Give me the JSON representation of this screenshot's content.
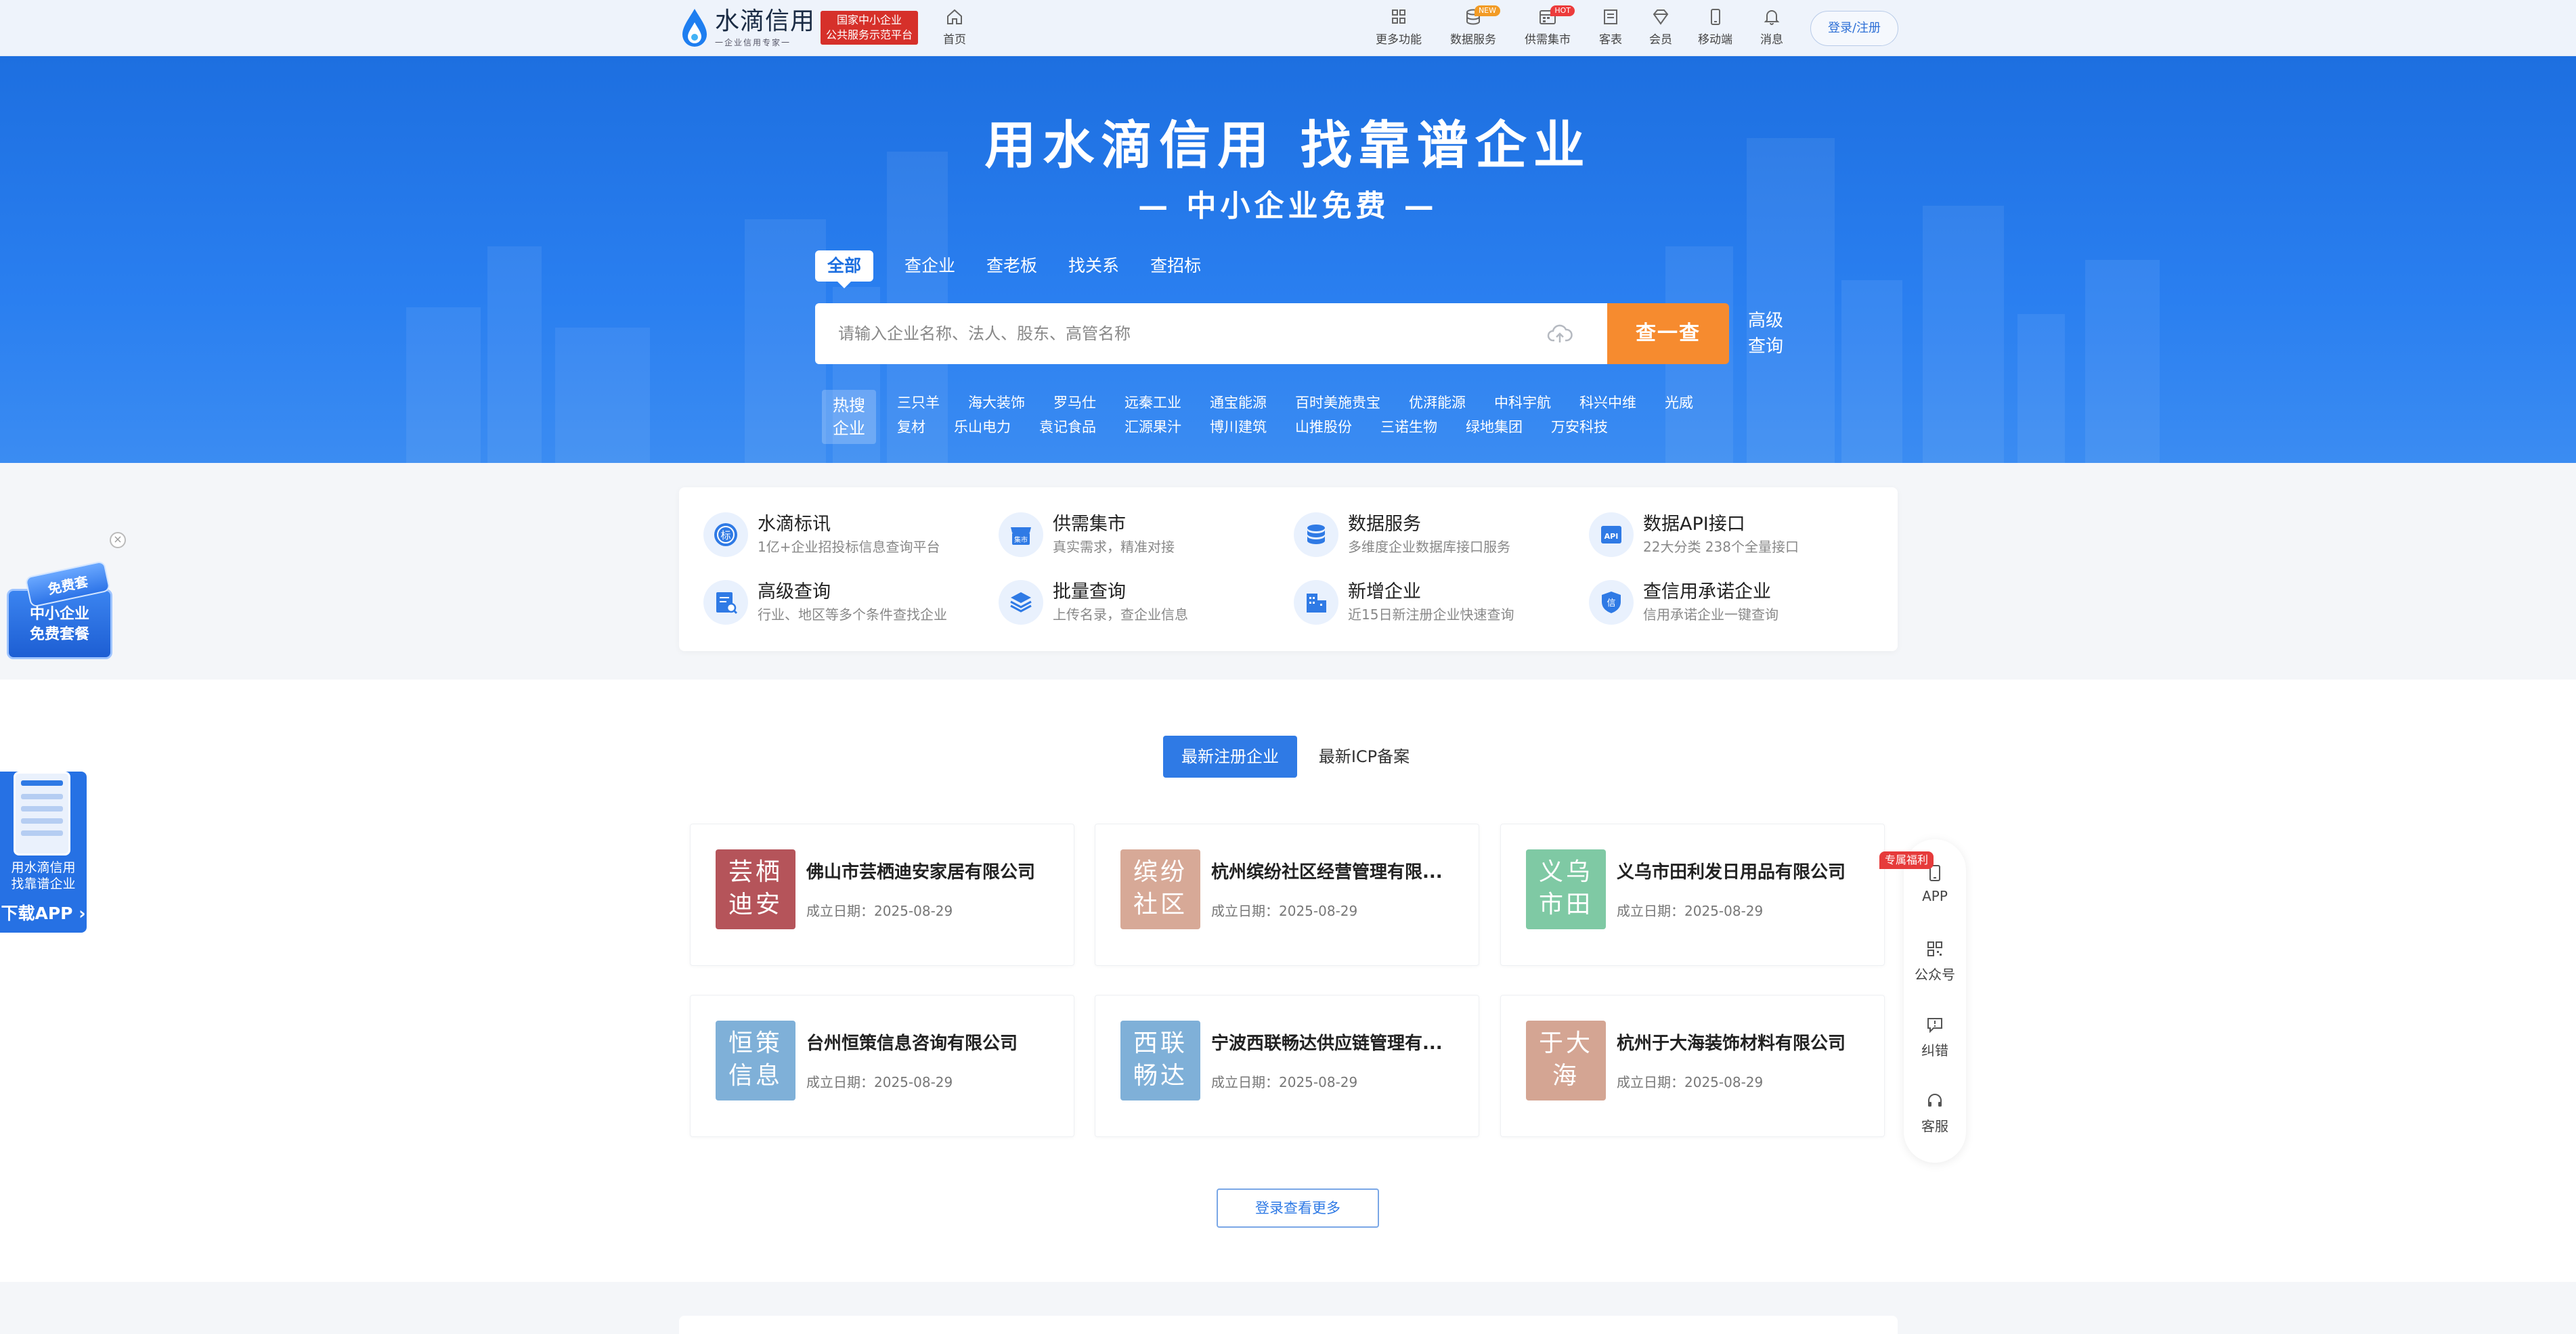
{
  "nav": {
    "logo_name": "水滴信用",
    "logo_slogan": "一企业信用专家一",
    "badge_line1": "国家中小企业",
    "badge_line2": "公共服务示范平台",
    "home": "首页",
    "items": [
      {
        "label": "更多功能",
        "icon": "grid-icon",
        "tag": ""
      },
      {
        "label": "数据服务",
        "icon": "database-icon",
        "tag": "NEW"
      },
      {
        "label": "供需集市",
        "icon": "calendar-icon",
        "tag": "HOT"
      },
      {
        "label": "客表",
        "icon": "book-icon",
        "tag": ""
      },
      {
        "label": "会员",
        "icon": "diamond-icon",
        "tag": ""
      },
      {
        "label": "移动端",
        "icon": "mobile-icon",
        "tag": ""
      },
      {
        "label": "消息",
        "icon": "bell-icon",
        "tag": ""
      }
    ],
    "login": "登录/注册"
  },
  "hero": {
    "title": "用水滴信用 找靠谱企业",
    "subtitle": "— 中小企业免费 —",
    "tabs": [
      "全部",
      "查企业",
      "查老板",
      "找关系",
      "查招标"
    ],
    "search_placeholder": "请输入企业名称、法人、股东、高管名称",
    "search_button": "查一查",
    "advanced_line1": "高级",
    "advanced_line2": "查询",
    "hot_label_line1": "热搜",
    "hot_label_line2": "企业",
    "hot_row1": [
      "三只羊",
      "海大装饰",
      "罗马仕",
      "远秦工业",
      "通宝能源",
      "百时美施贵宝",
      "优湃能源",
      "中科宇航",
      "科兴中维",
      "光威"
    ],
    "hot_row2": [
      "复材",
      "乐山电力",
      "袁记食品",
      "汇源果汁",
      "博川建筑",
      "山推股份",
      "三诺生物",
      "绿地集团",
      "万安科技"
    ]
  },
  "services": [
    {
      "title": "水滴标讯",
      "desc": "1亿+企业招投标信息查询平台",
      "icon": "bid-icon"
    },
    {
      "title": "供需集市",
      "desc": "真实需求，精准对接",
      "icon": "market-icon"
    },
    {
      "title": "数据服务",
      "desc": "多维度企业数据库接口服务",
      "icon": "database-icon"
    },
    {
      "title": "数据API接口",
      "desc": "22大分类 238个全量接口",
      "icon": "api-icon"
    },
    {
      "title": "高级查询",
      "desc": "行业、地区等多个条件查找企业",
      "icon": "advanced-search-icon"
    },
    {
      "title": "批量查询",
      "desc": "上传名录，查企业信息",
      "icon": "layers-icon"
    },
    {
      "title": "新增企业",
      "desc": "近15日新注册企业快速查询",
      "icon": "building-icon"
    },
    {
      "title": "查信用承诺企业",
      "desc": "信用承诺企业一键查询",
      "icon": "credit-shield-icon"
    }
  ],
  "list": {
    "tab_active": "最新注册企业",
    "tab_other": "最新ICP备案",
    "companies": [
      {
        "avatar": "芸栖迪安",
        "name": "佛山市芸栖迪安家居有限公司",
        "date": "成立日期：2025-08-29",
        "color": "#b5545a"
      },
      {
        "avatar": "缤纷社区",
        "name": "杭州缤纷社区经营管理有限...",
        "date": "成立日期：2025-08-29",
        "color": "#d7a997"
      },
      {
        "avatar": "义乌市田",
        "name": "义乌市田利发日用品有限公司",
        "date": "成立日期：2025-08-29",
        "color": "#7fc9a4"
      },
      {
        "avatar": "恒策信息",
        "name": "台州恒策信息咨询有限公司",
        "date": "成立日期：2025-08-29",
        "color": "#7fb0d8"
      },
      {
        "avatar": "西联畅达",
        "name": "宁波西联畅达供应链管理有...",
        "date": "成立日期：2025-08-29",
        "color": "#7fb0d8"
      },
      {
        "avatar": "于大海",
        "name": "杭州于大海装饰材料有限公司",
        "date": "成立日期：2025-08-29",
        "color": "#d4a593"
      }
    ],
    "more": "登录查看更多"
  },
  "rightbar": {
    "badge": "专属福利",
    "items": [
      {
        "label": "APP",
        "icon": "app-icon"
      },
      {
        "label": "公众号",
        "icon": "qrcode-icon"
      },
      {
        "label": "纠错",
        "icon": "feedback-icon"
      },
      {
        "label": "客服",
        "icon": "headset-icon"
      }
    ]
  },
  "left_float": {
    "tag": "免费套",
    "line1": "中小企业",
    "line2": "免费套餐",
    "app_line1": "用水滴信用",
    "app_line2": "找靠谱企业",
    "app_download": "下载APP"
  }
}
